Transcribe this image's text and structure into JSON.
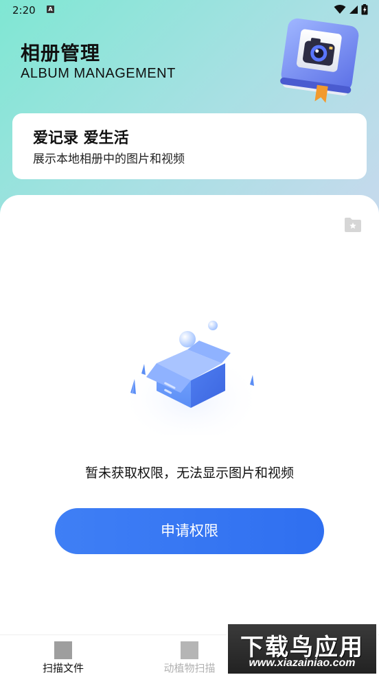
{
  "status_bar": {
    "time": "2:20",
    "notification_icon": "A",
    "icons": [
      "wifi-icon",
      "signal-icon",
      "battery-icon"
    ]
  },
  "header": {
    "title": "相册管理",
    "subtitle": "ALBUM MANAGEMENT",
    "illustration": "album-camera-illustration"
  },
  "info_card": {
    "title": "爱记录 爱生活",
    "description": "展示本地相册中的图片和视频"
  },
  "main": {
    "folder_icon": "star-folder-icon",
    "empty_illustration": "empty-box-illustration",
    "empty_message": "暂未获取权限，无法显示图片和视频",
    "request_button_label": "申请权限"
  },
  "bottom_nav": {
    "items": [
      {
        "label": "扫描文件",
        "active": true
      },
      {
        "label": "动植物扫描",
        "active": false
      }
    ]
  },
  "watermark": {
    "main": "下载鸟应用",
    "url": "www.xiazainiao.com"
  },
  "colors": {
    "accent": "#3f7ff5",
    "background_gradient_start": "#7fe7d3",
    "background_gradient_end": "#e2d7f6"
  }
}
